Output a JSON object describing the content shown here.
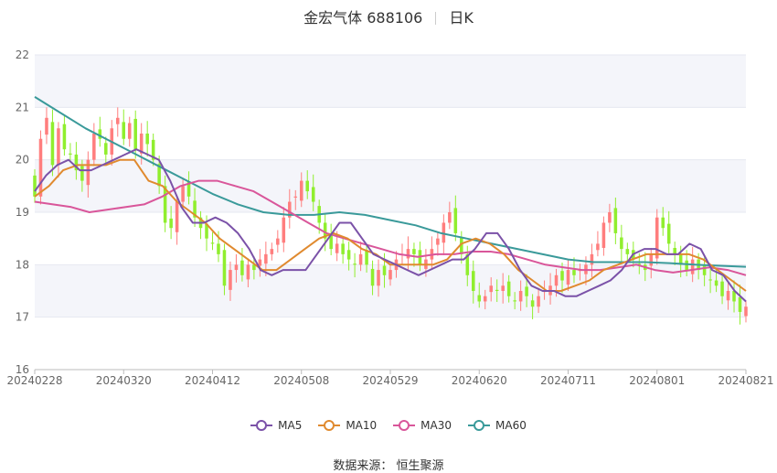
{
  "title": {
    "name": "金宏气体 688106",
    "period": "日K"
  },
  "source": "数据来源： 恒生聚源",
  "colors": {
    "up": "#ff7e7e",
    "down": "#90ee2e",
    "MA5": "#7b52a8",
    "MA10": "#e08a2f",
    "MA30": "#d9569a",
    "MA60": "#3a9a9a",
    "grid": "#e6e8f0",
    "band": "#f4f5fa"
  },
  "chart_data": {
    "type": "candlestick",
    "ylim": [
      16,
      22
    ],
    "yticks": [
      16,
      17,
      18,
      19,
      20,
      21,
      22
    ],
    "xticks": [
      "20240228",
      "20240320",
      "20240412",
      "20240508",
      "20240529",
      "20240620",
      "20240711",
      "20240801",
      "20240821"
    ],
    "xtick_index": [
      0,
      15,
      30,
      45,
      60,
      75,
      90,
      105,
      120
    ],
    "legend": [
      "MA5",
      "MA10",
      "MA30",
      "MA60"
    ],
    "closes": [
      19.3,
      20.4,
      20.8,
      19.9,
      20.6,
      20.2,
      20.1,
      19.8,
      19.6,
      20.0,
      20.5,
      20.4,
      20.1,
      20.6,
      20.8,
      20.4,
      20.7,
      20.2,
      20.5,
      20.3,
      20.0,
      19.5,
      18.8,
      18.7,
      19.2,
      19.5,
      19.3,
      18.9,
      18.7,
      18.5,
      18.4,
      18.2,
      17.6,
      17.9,
      18.0,
      17.8,
      18.0,
      17.9,
      18.1,
      18.2,
      18.3,
      18.5,
      18.9,
      19.2,
      19.3,
      19.6,
      19.4,
      19.2,
      18.8,
      18.5,
      18.3,
      18.4,
      18.2,
      18.1,
      18.0,
      18.2,
      18.0,
      17.6,
      17.9,
      17.8,
      17.9,
      18.1,
      18.2,
      18.3,
      18.2,
      18.0,
      18.1,
      18.3,
      18.5,
      18.8,
      19.0,
      18.6,
      18.2,
      17.8,
      17.5,
      17.3,
      17.4,
      17.6,
      17.5,
      17.6,
      17.4,
      17.3,
      17.5,
      17.4,
      17.2,
      17.4,
      17.5,
      17.6,
      17.8,
      17.7,
      17.9,
      17.8,
      17.9,
      18.0,
      18.2,
      18.4,
      18.8,
      19.0,
      18.6,
      18.3,
      18.2,
      18.1,
      18.0,
      17.9,
      18.2,
      18.9,
      18.7,
      18.4,
      18.2,
      18.0,
      17.9,
      18.1,
      17.9,
      17.8,
      17.7,
      17.6,
      17.4,
      17.5,
      17.3,
      17.1,
      17.2
    ],
    "ma5": [
      19.4,
      19.7,
      19.9,
      20.0,
      19.8,
      19.8,
      19.9,
      20.0,
      20.1,
      20.2,
      20.1,
      20.0,
      19.6,
      19.1,
      18.8,
      18.8,
      18.9,
      18.8,
      18.6,
      18.3,
      17.9,
      17.8,
      17.9,
      17.9,
      17.9,
      18.2,
      18.5,
      18.8,
      18.8,
      18.5,
      18.2,
      18.1,
      18.0,
      17.9,
      17.8,
      17.9,
      18.0,
      18.1,
      18.1,
      18.3,
      18.6,
      18.6,
      18.3,
      17.9,
      17.6,
      17.5,
      17.5,
      17.4,
      17.4,
      17.5,
      17.6,
      17.7,
      17.9,
      18.2,
      18.3,
      18.3,
      18.2,
      18.2,
      18.4,
      18.3,
      17.9,
      17.8,
      17.5,
      17.3
    ],
    "ma10": [
      19.3,
      19.5,
      19.8,
      19.9,
      19.9,
      19.9,
      20.0,
      20.0,
      19.6,
      19.5,
      19.2,
      19.0,
      18.8,
      18.5,
      18.3,
      18.1,
      17.9,
      17.9,
      18.1,
      18.3,
      18.5,
      18.6,
      18.5,
      18.3,
      18.2,
      18.0,
      18.0,
      18.0,
      18.0,
      18.1,
      18.4,
      18.5,
      18.4,
      18.2,
      17.9,
      17.7,
      17.5,
      17.5,
      17.6,
      17.7,
      17.9,
      18.0,
      18.1,
      18.2,
      18.2,
      18.2,
      18.2,
      18.1,
      17.9,
      17.7,
      17.5
    ],
    "ma30": [
      19.2,
      19.15,
      19.1,
      19.0,
      19.05,
      19.1,
      19.15,
      19.3,
      19.5,
      19.6,
      19.6,
      19.5,
      19.4,
      19.2,
      19.0,
      18.8,
      18.6,
      18.5,
      18.4,
      18.3,
      18.2,
      18.15,
      18.2,
      18.2,
      18.25,
      18.25,
      18.2,
      18.1,
      18.0,
      17.95,
      17.9,
      17.9,
      17.95,
      18.0,
      17.9,
      17.85,
      17.9,
      17.95,
      17.9,
      17.8
    ],
    "ma60": [
      21.2,
      20.9,
      20.6,
      20.35,
      20.1,
      19.85,
      19.6,
      19.35,
      19.15,
      19.0,
      18.95,
      18.95,
      19.0,
      18.95,
      18.85,
      18.75,
      18.6,
      18.5,
      18.4,
      18.3,
      18.2,
      18.1,
      18.05,
      18.05,
      18.05,
      18.03,
      18.0,
      17.98,
      17.96
    ]
  }
}
